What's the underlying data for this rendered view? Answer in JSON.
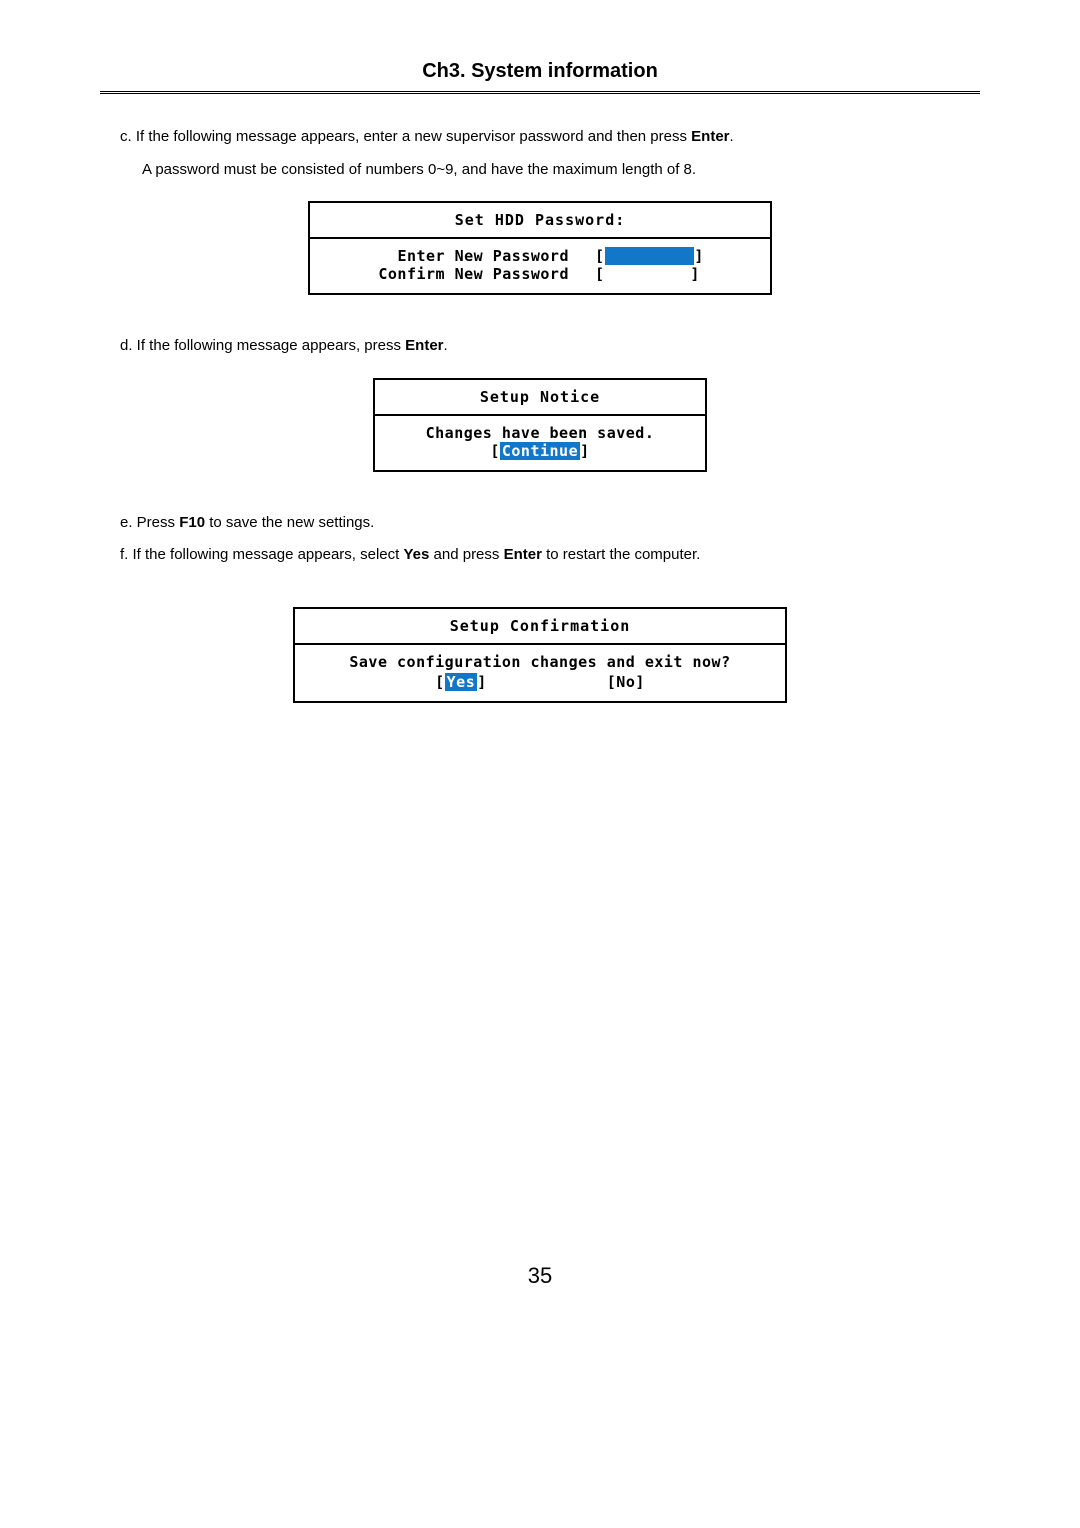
{
  "header": {
    "chapter": "Ch3. System information"
  },
  "paras": {
    "c_line1": "c. If the following message appears, enter a new supervisor password and then press ",
    "c_enter": "Enter",
    "c_period": ".",
    "c_line2": "A password must be consisted of numbers 0~9, and have the maximum length of 8.",
    "d_line": "d. If the following message appears, press ",
    "d_enter": "Enter",
    "d_period": ".",
    "e_line_pre": "e. Press ",
    "e_f10": "F10",
    "e_line_post": " to save the new settings.",
    "f_line_pre": "f. If the following message appears, select ",
    "f_yes": "Yes",
    "f_mid": " and press ",
    "f_enter": "Enter",
    "f_post": " to restart the computer."
  },
  "bios_hdd": {
    "title": "Set HDD Password:",
    "enter_label": "Enter New Password",
    "confirm_label": "Confirm New Password",
    "bracket_open": "[",
    "bracket_close": "]"
  },
  "bios_notice": {
    "title": "Setup Notice",
    "msg": "Changes have been saved.",
    "continue": "Continue"
  },
  "bios_confirm": {
    "title": "Setup Confirmation",
    "msg": "Save configuration changes and exit now?",
    "yes": "Yes",
    "no": "No"
  },
  "page_number": "35"
}
